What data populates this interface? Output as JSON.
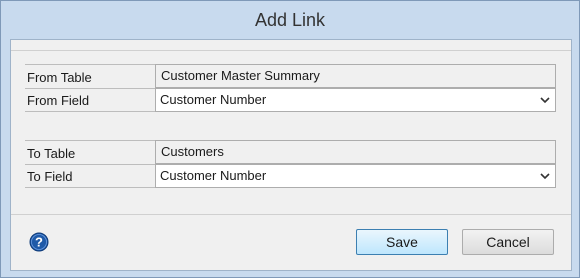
{
  "dialog": {
    "title": "Add Link"
  },
  "from": {
    "table_label": "From Table",
    "table_value": "Customer Master Summary",
    "field_label": "From Field",
    "field_value": "Customer Number"
  },
  "to": {
    "table_label": "To Table",
    "table_value": "Customers",
    "field_label": "To Field",
    "field_value": "Customer Number"
  },
  "buttons": {
    "save": "Save",
    "cancel": "Cancel"
  },
  "icons": {
    "help": "help-icon",
    "dropdown": "chevron-down-icon"
  },
  "colors": {
    "frame": "#c8daee",
    "help_blue": "#1f5aa8",
    "save_border": "#3c7fb1"
  }
}
